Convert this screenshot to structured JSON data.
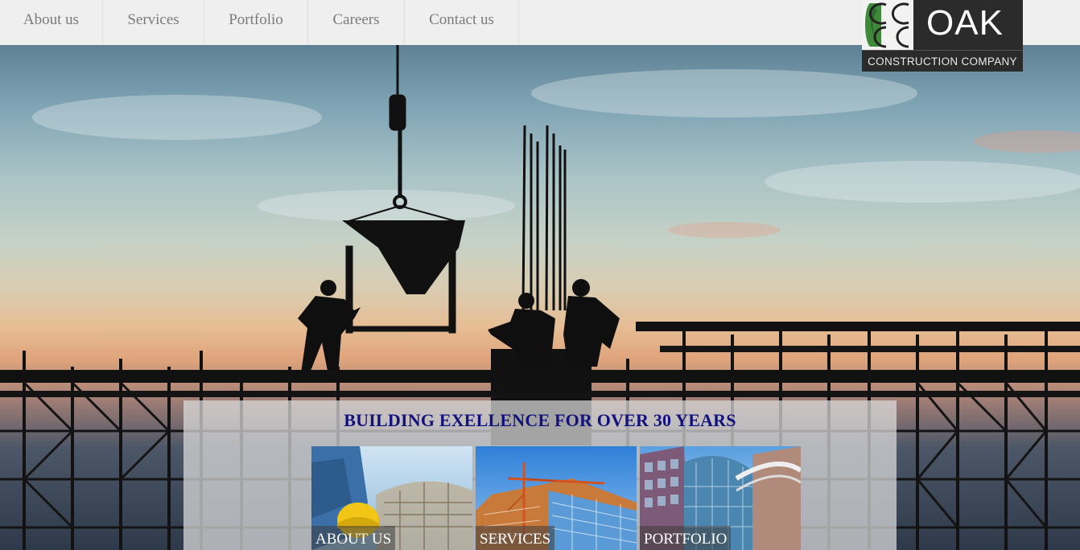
{
  "nav": {
    "items": [
      {
        "label": "About us"
      },
      {
        "label": "Services"
      },
      {
        "label": "Portfolio"
      },
      {
        "label": "Careers"
      },
      {
        "label": "Contact us"
      }
    ]
  },
  "logo": {
    "word": "OAK",
    "subtitle": "CONSTRUCTION COMPANY"
  },
  "hero": {
    "tagline": "BUILDING EXELLENCE FOR OVER 30 YEARS",
    "tiles": [
      {
        "label": "ABOUT US"
      },
      {
        "label": "SERVICES"
      },
      {
        "label": "PORTFOLIO"
      }
    ]
  },
  "colors": {
    "tagline": "#13127d",
    "nav_text": "#7a7a7a",
    "logo_bg": "#2b2b2b",
    "logo_green": "#3f8a3a"
  }
}
